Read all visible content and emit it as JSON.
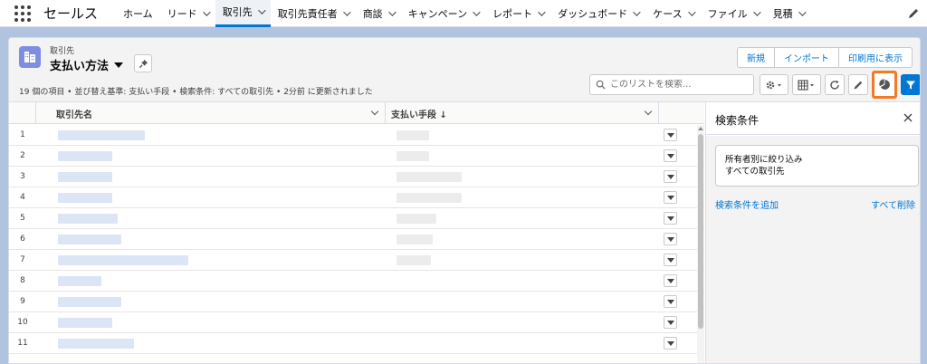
{
  "app": {
    "name": "セールス"
  },
  "nav": {
    "items": [
      {
        "label": "ホーム",
        "chevron": false,
        "active": false
      },
      {
        "label": "リード",
        "chevron": true,
        "active": false
      },
      {
        "label": "取引先",
        "chevron": true,
        "active": true
      },
      {
        "label": "取引先責任者",
        "chevron": true,
        "active": false
      },
      {
        "label": "商談",
        "chevron": true,
        "active": false
      },
      {
        "label": "キャンペーン",
        "chevron": true,
        "active": false
      },
      {
        "label": "レポート",
        "chevron": true,
        "active": false
      },
      {
        "label": "ダッシュボード",
        "chevron": true,
        "active": false
      },
      {
        "label": "ケース",
        "chevron": true,
        "active": false
      },
      {
        "label": "ファイル",
        "chevron": true,
        "active": false
      },
      {
        "label": "見積",
        "chevron": true,
        "active": false
      }
    ]
  },
  "header": {
    "object_label": "取引先",
    "list_view_name": "支払い方法",
    "info": "19 個の項目 • 並び替え基準: 支払い手段 • 検索条件: すべての取引先 • 2分前 に更新されました",
    "buttons": {
      "new": "新規",
      "import": "インポート",
      "print": "印刷用に表示"
    },
    "search_placeholder": "このリストを検索..."
  },
  "table": {
    "columns": {
      "account_name": "取引先名",
      "payment_method": "支払い手段 ↓"
    },
    "rows": [
      "1",
      "2",
      "3",
      "4",
      "5",
      "6",
      "7",
      "8",
      "9",
      "10",
      "11"
    ]
  },
  "filter_panel": {
    "title": "検索条件",
    "filter_line1": "所有者別に絞り込み",
    "filter_line2": "すべての取引先",
    "add_filter": "検索条件を追加",
    "remove_all": "すべて削除"
  },
  "colors": {
    "brand": "#0176d3",
    "highlight": "#f27a25",
    "object_icon": "#7f8de1"
  }
}
